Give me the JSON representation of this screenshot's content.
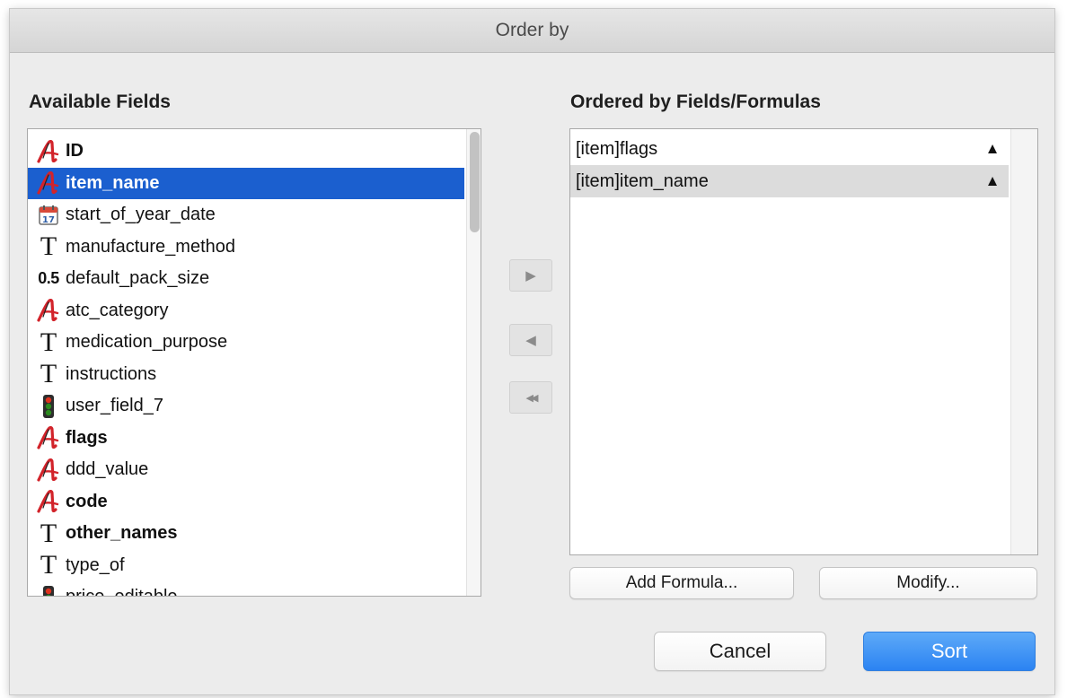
{
  "dialog": {
    "title": "Order by"
  },
  "available": {
    "label": "Available Fields",
    "items": [
      {
        "label": "ID",
        "icon": "alpha-icon",
        "bold": true,
        "selected": false
      },
      {
        "label": "item_name",
        "icon": "alpha-icon",
        "bold": true,
        "selected": true
      },
      {
        "label": "start_of_year_date",
        "icon": "calendar-icon",
        "bold": false,
        "selected": false
      },
      {
        "label": "manufacture_method",
        "icon": "text-icon",
        "bold": false,
        "selected": false
      },
      {
        "label": "default_pack_size",
        "icon": "number-icon",
        "bold": false,
        "selected": false
      },
      {
        "label": "atc_category",
        "icon": "alpha-icon",
        "bold": false,
        "selected": false
      },
      {
        "label": "medication_purpose",
        "icon": "text-icon",
        "bold": false,
        "selected": false
      },
      {
        "label": "instructions",
        "icon": "text-icon",
        "bold": false,
        "selected": false
      },
      {
        "label": "user_field_7",
        "icon": "boolean-icon",
        "bold": false,
        "selected": false
      },
      {
        "label": "flags",
        "icon": "alpha-icon",
        "bold": true,
        "selected": false
      },
      {
        "label": "ddd_value",
        "icon": "alpha-icon",
        "bold": false,
        "selected": false
      },
      {
        "label": "code",
        "icon": "alpha-icon",
        "bold": true,
        "selected": false
      },
      {
        "label": "other_names",
        "icon": "text-icon",
        "bold": true,
        "selected": false
      },
      {
        "label": "type_of",
        "icon": "text-icon",
        "bold": false,
        "selected": false
      },
      {
        "label": "price_editable",
        "icon": "boolean-icon",
        "bold": false,
        "selected": false
      }
    ],
    "number_icon_text": "0.5",
    "calendar_icon_text": "17"
  },
  "transfer": {
    "add_glyph": "▶",
    "remove_glyph": "◀",
    "remove_all_glyph": "◀◀"
  },
  "ordered": {
    "label": "Ordered by Fields/Formulas",
    "items": [
      {
        "label": "[item]flags",
        "direction": "▲",
        "selected": false
      },
      {
        "label": "[item]item_name",
        "direction": "▲",
        "selected": true
      }
    ]
  },
  "buttons": {
    "add_formula": "Add Formula...",
    "modify": "Modify...",
    "cancel": "Cancel",
    "sort": "Sort"
  },
  "colors": {
    "selection": "#1b5fcf",
    "primary_button": "#2b83f2",
    "alpha_icon": "#d2232a"
  }
}
